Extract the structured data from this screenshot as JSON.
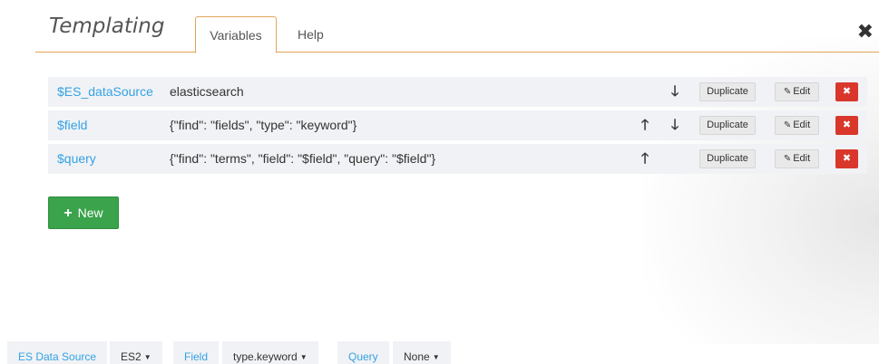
{
  "header": {
    "title": "Templating",
    "tabs": [
      {
        "label": "Variables",
        "active": true
      },
      {
        "label": "Help",
        "active": false
      }
    ],
    "close_glyph": "✖"
  },
  "variables": [
    {
      "name": "$ES_dataSource",
      "query": "elasticsearch",
      "up": false,
      "down": true
    },
    {
      "name": "$field",
      "query": "{\"find\": \"fields\", \"type\": \"keyword\"}",
      "up": true,
      "down": true
    },
    {
      "name": "$query",
      "query": "{\"find\": \"terms\", \"field\": \"$field\", \"query\": \"$field\"}",
      "up": true,
      "down": false
    }
  ],
  "row_actions": {
    "duplicate_label": "Duplicate",
    "edit_label": "Edit",
    "edit_icon": "pencil-square-icon",
    "delete_glyph": "✖",
    "up_glyph": "🡑",
    "down_glyph": "🡓"
  },
  "new_button": {
    "label": "New",
    "icon": "plus-icon"
  },
  "submenu": [
    {
      "label": "ES Data Source",
      "value": "ES2"
    },
    {
      "label": "Field",
      "value": "type.keyword"
    },
    {
      "label": "Query",
      "value": "None"
    }
  ],
  "colors": {
    "accent_border": "#e3a45a",
    "link": "#33a2e5",
    "danger": "#d9372b",
    "success": "#3aa34b",
    "row_bg": "#f1f2f5"
  }
}
